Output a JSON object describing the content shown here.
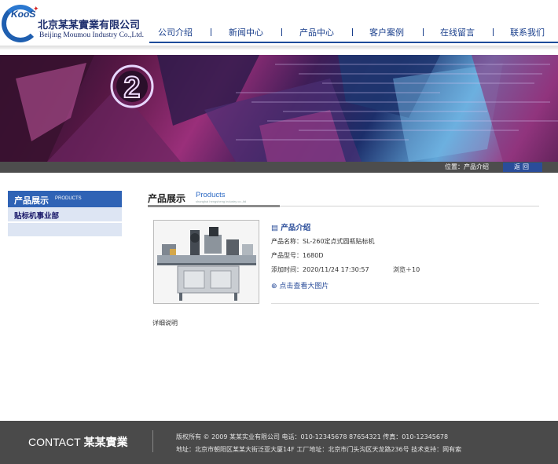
{
  "header": {
    "logo_mark": "KooS",
    "company_cn": "北京某某實業有限公司",
    "company_en": "Beijing Moumou Industry Co.,Ltd."
  },
  "nav": {
    "items": [
      {
        "label": "公司介绍"
      },
      {
        "label": "新闻中心"
      },
      {
        "label": "产品中心"
      },
      {
        "label": "客户案例"
      },
      {
        "label": "在线留言"
      },
      {
        "label": "联系我们"
      }
    ]
  },
  "breadcrumb": {
    "text": "位置：产品介绍",
    "back_label": "返回"
  },
  "sidebar": {
    "title": "产品展示",
    "title_sub": "PRODUCTS",
    "items": [
      {
        "label": "贴标机事业部"
      }
    ]
  },
  "main": {
    "title": "产品展示",
    "title_en": "Products",
    "title_en_small": "shanghai hengsheng industry co.,ltd",
    "product": {
      "section_title": "产品介绍",
      "name_row": "产品名称：SL-260定点式圆瓶贴标机",
      "model_row": "产品型号：1680D",
      "date_row": "添加时间：2020/11/24 17:30:57",
      "views_row": "浏览＋10",
      "view_large_label": "点击查看大图片"
    },
    "detail_label": "详细说明"
  },
  "footer": {
    "contact": "CONTACT",
    "brand_cn": "某某實業",
    "line1": "版权所有  © 2009 某某实业有限公司    电话：010-12345678 87654321    传真：010-12345678",
    "line2": "地址：北京市朝阳区某某大街泛亚大厦14F   工厂地址：北京市门头沟区天龙路236号   技术支持：网有索"
  },
  "colors": {
    "brand_blue": "#2f63b5",
    "nav_blue": "#1a3f8c",
    "footer_bg": "#4a4a4a",
    "crumb_bg": "#4d4d4d"
  },
  "icons": {
    "section_icon": "document-icon",
    "view_icon": "magnifier-plus-icon"
  }
}
